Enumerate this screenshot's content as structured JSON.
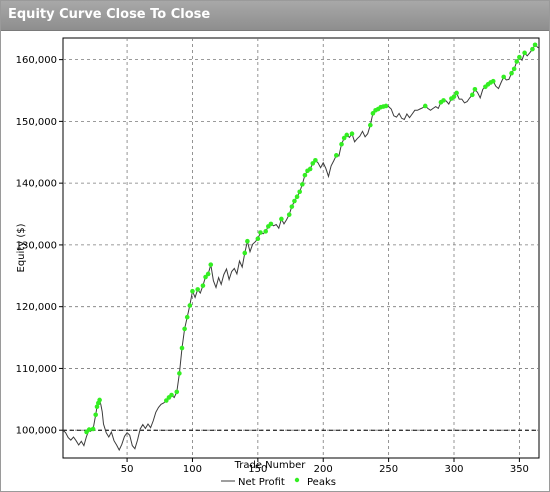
{
  "window": {
    "title": "Equity Curve Close To Close"
  },
  "chart_data": {
    "type": "line",
    "title": "",
    "xlabel": "Trade Number",
    "ylabel": "Equity ($)",
    "xlim": [
      1,
      365
    ],
    "ylim": [
      95500,
      163500
    ],
    "x_ticks": [
      50,
      100,
      150,
      200,
      250,
      300,
      350
    ],
    "y_ticks": [
      100000,
      110000,
      120000,
      130000,
      140000,
      150000,
      160000
    ],
    "x_tick_labels": [
      "50",
      "100",
      "150",
      "200",
      "250",
      "300",
      "350"
    ],
    "y_tick_labels": [
      "100,000",
      "110,000",
      "120,000",
      "130,000",
      "140,000",
      "150,000",
      "160,000"
    ],
    "grid": "dashed",
    "reference_line": 100000,
    "legend": {
      "placement": "bottom",
      "entries": [
        "Net Profit",
        "Peaks"
      ]
    },
    "colors": {
      "line": "#3c3c3c",
      "peaks": "#33ee22",
      "grid": "#7a7a7a"
    },
    "series": [
      {
        "name": "Net Profit",
        "points": [
          [
            1,
            100000
          ],
          [
            3,
            99600
          ],
          [
            5,
            98800
          ],
          [
            7,
            98400
          ],
          [
            9,
            98900
          ],
          [
            11,
            98300
          ],
          [
            13,
            97600
          ],
          [
            15,
            98200
          ],
          [
            17,
            97500
          ],
          [
            19,
            99000
          ],
          [
            21,
            100100
          ],
          [
            22,
            99800
          ],
          [
            24,
            100200
          ],
          [
            26,
            102500
          ],
          [
            27,
            103800
          ],
          [
            28,
            104400
          ],
          [
            29,
            104900
          ],
          [
            30,
            104100
          ],
          [
            31,
            103000
          ],
          [
            32,
            101000
          ],
          [
            34,
            99600
          ],
          [
            36,
            98900
          ],
          [
            38,
            99700
          ],
          [
            40,
            98300
          ],
          [
            42,
            97600
          ],
          [
            44,
            96800
          ],
          [
            46,
            97700
          ],
          [
            48,
            99000
          ],
          [
            50,
            99600
          ],
          [
            52,
            99200
          ],
          [
            54,
            97500
          ],
          [
            56,
            97000
          ],
          [
            58,
            98400
          ],
          [
            60,
            100200
          ],
          [
            62,
            100900
          ],
          [
            64,
            100300
          ],
          [
            66,
            101000
          ],
          [
            68,
            100400
          ],
          [
            70,
            101500
          ],
          [
            72,
            102900
          ],
          [
            74,
            103700
          ],
          [
            76,
            104200
          ],
          [
            78,
            104400
          ],
          [
            80,
            104800
          ],
          [
            82,
            105300
          ],
          [
            84,
            105700
          ],
          [
            86,
            105300
          ],
          [
            88,
            106200
          ],
          [
            90,
            109200
          ],
          [
            92,
            113300
          ],
          [
            94,
            116400
          ],
          [
            96,
            118300
          ],
          [
            98,
            120200
          ],
          [
            100,
            122500
          ],
          [
            102,
            121500
          ],
          [
            104,
            122800
          ],
          [
            106,
            122200
          ],
          [
            108,
            123400
          ],
          [
            110,
            124800
          ],
          [
            112,
            125300
          ],
          [
            114,
            126800
          ],
          [
            116,
            124200
          ],
          [
            118,
            123100
          ],
          [
            120,
            124700
          ],
          [
            122,
            123600
          ],
          [
            124,
            125200
          ],
          [
            126,
            126100
          ],
          [
            128,
            124400
          ],
          [
            130,
            125700
          ],
          [
            132,
            126200
          ],
          [
            134,
            125300
          ],
          [
            136,
            127400
          ],
          [
            138,
            126400
          ],
          [
            140,
            128700
          ],
          [
            142,
            130600
          ],
          [
            144,
            128900
          ],
          [
            146,
            130100
          ],
          [
            148,
            130500
          ],
          [
            150,
            131000
          ],
          [
            152,
            132000
          ],
          [
            154,
            131800
          ],
          [
            156,
            132200
          ],
          [
            158,
            133000
          ],
          [
            160,
            133400
          ],
          [
            162,
            133100
          ],
          [
            164,
            133300
          ],
          [
            166,
            132700
          ],
          [
            168,
            134200
          ],
          [
            170,
            133400
          ],
          [
            172,
            134100
          ],
          [
            174,
            134900
          ],
          [
            176,
            136200
          ],
          [
            178,
            137100
          ],
          [
            180,
            137800
          ],
          [
            182,
            138600
          ],
          [
            184,
            139800
          ],
          [
            186,
            141300
          ],
          [
            188,
            142000
          ],
          [
            190,
            142300
          ],
          [
            192,
            143200
          ],
          [
            194,
            143700
          ],
          [
            196,
            143300
          ],
          [
            198,
            142500
          ],
          [
            200,
            143300
          ],
          [
            202,
            142400
          ],
          [
            204,
            141100
          ],
          [
            206,
            142800
          ],
          [
            208,
            143600
          ],
          [
            210,
            144500
          ],
          [
            212,
            144400
          ],
          [
            214,
            146300
          ],
          [
            216,
            147300
          ],
          [
            218,
            147800
          ],
          [
            220,
            147400
          ],
          [
            222,
            148000
          ],
          [
            224,
            146700
          ],
          [
            226,
            147200
          ],
          [
            228,
            147600
          ],
          [
            230,
            148400
          ],
          [
            232,
            147500
          ],
          [
            234,
            148000
          ],
          [
            236,
            149400
          ],
          [
            238,
            151300
          ],
          [
            240,
            151800
          ],
          [
            242,
            152000
          ],
          [
            244,
            152300
          ],
          [
            246,
            152400
          ],
          [
            248,
            152500
          ],
          [
            250,
            152400
          ],
          [
            252,
            152000
          ],
          [
            254,
            150900
          ],
          [
            256,
            150700
          ],
          [
            258,
            151300
          ],
          [
            260,
            150500
          ],
          [
            262,
            150300
          ],
          [
            264,
            151200
          ],
          [
            266,
            150600
          ],
          [
            268,
            151200
          ],
          [
            270,
            151800
          ],
          [
            272,
            151800
          ],
          [
            274,
            152000
          ],
          [
            276,
            152200
          ],
          [
            278,
            152500
          ],
          [
            280,
            152100
          ],
          [
            282,
            151800
          ],
          [
            284,
            152100
          ],
          [
            286,
            152400
          ],
          [
            288,
            152100
          ],
          [
            290,
            153100
          ],
          [
            292,
            153400
          ],
          [
            294,
            153300
          ],
          [
            296,
            152800
          ],
          [
            298,
            153700
          ],
          [
            300,
            154000
          ],
          [
            302,
            154600
          ],
          [
            304,
            153600
          ],
          [
            306,
            153600
          ],
          [
            308,
            153000
          ],
          [
            310,
            153200
          ],
          [
            312,
            153800
          ],
          [
            314,
            154300
          ],
          [
            316,
            155200
          ],
          [
            318,
            154700
          ],
          [
            320,
            153800
          ],
          [
            322,
            155200
          ],
          [
            324,
            155600
          ],
          [
            326,
            156000
          ],
          [
            328,
            156300
          ],
          [
            330,
            156500
          ],
          [
            332,
            155700
          ],
          [
            334,
            155300
          ],
          [
            336,
            156300
          ],
          [
            338,
            157200
          ],
          [
            340,
            156700
          ],
          [
            342,
            156800
          ],
          [
            344,
            157800
          ],
          [
            346,
            158500
          ],
          [
            348,
            159700
          ],
          [
            350,
            160400
          ],
          [
            352,
            159900
          ],
          [
            354,
            161100
          ],
          [
            356,
            160600
          ],
          [
            358,
            161100
          ],
          [
            360,
            161700
          ],
          [
            362,
            162400
          ],
          [
            364,
            162000
          ],
          [
            365,
            161900
          ]
        ]
      },
      {
        "name": "Peaks",
        "points": [
          [
            19,
            99700
          ],
          [
            21,
            100100
          ],
          [
            24,
            100200
          ],
          [
            26,
            102500
          ],
          [
            27,
            103800
          ],
          [
            28,
            104400
          ],
          [
            29,
            104900
          ],
          [
            80,
            104800
          ],
          [
            82,
            105300
          ],
          [
            84,
            105700
          ],
          [
            88,
            106200
          ],
          [
            90,
            109200
          ],
          [
            92,
            113300
          ],
          [
            94,
            116400
          ],
          [
            96,
            118300
          ],
          [
            98,
            120200
          ],
          [
            100,
            122500
          ],
          [
            104,
            122800
          ],
          [
            108,
            123400
          ],
          [
            110,
            124800
          ],
          [
            112,
            125300
          ],
          [
            114,
            126800
          ],
          [
            140,
            128700
          ],
          [
            142,
            130600
          ],
          [
            150,
            131000
          ],
          [
            152,
            132000
          ],
          [
            156,
            132200
          ],
          [
            158,
            133000
          ],
          [
            160,
            133400
          ],
          [
            168,
            134200
          ],
          [
            174,
            134900
          ],
          [
            176,
            136200
          ],
          [
            178,
            137100
          ],
          [
            180,
            137800
          ],
          [
            182,
            138600
          ],
          [
            184,
            139800
          ],
          [
            186,
            141300
          ],
          [
            188,
            142000
          ],
          [
            190,
            142300
          ],
          [
            192,
            143200
          ],
          [
            194,
            143700
          ],
          [
            210,
            144500
          ],
          [
            214,
            146300
          ],
          [
            216,
            147300
          ],
          [
            218,
            147800
          ],
          [
            222,
            148000
          ],
          [
            236,
            149400
          ],
          [
            238,
            151300
          ],
          [
            240,
            151800
          ],
          [
            242,
            152000
          ],
          [
            244,
            152300
          ],
          [
            246,
            152400
          ],
          [
            248,
            152500
          ],
          [
            278,
            152500
          ],
          [
            290,
            153100
          ],
          [
            292,
            153400
          ],
          [
            298,
            153700
          ],
          [
            300,
            154000
          ],
          [
            302,
            154600
          ],
          [
            314,
            154300
          ],
          [
            316,
            155200
          ],
          [
            324,
            155600
          ],
          [
            326,
            156000
          ],
          [
            328,
            156300
          ],
          [
            330,
            156500
          ],
          [
            338,
            157200
          ],
          [
            344,
            157800
          ],
          [
            346,
            158500
          ],
          [
            348,
            159700
          ],
          [
            350,
            160400
          ],
          [
            354,
            161100
          ],
          [
            360,
            161700
          ],
          [
            362,
            162400
          ]
        ]
      }
    ]
  }
}
